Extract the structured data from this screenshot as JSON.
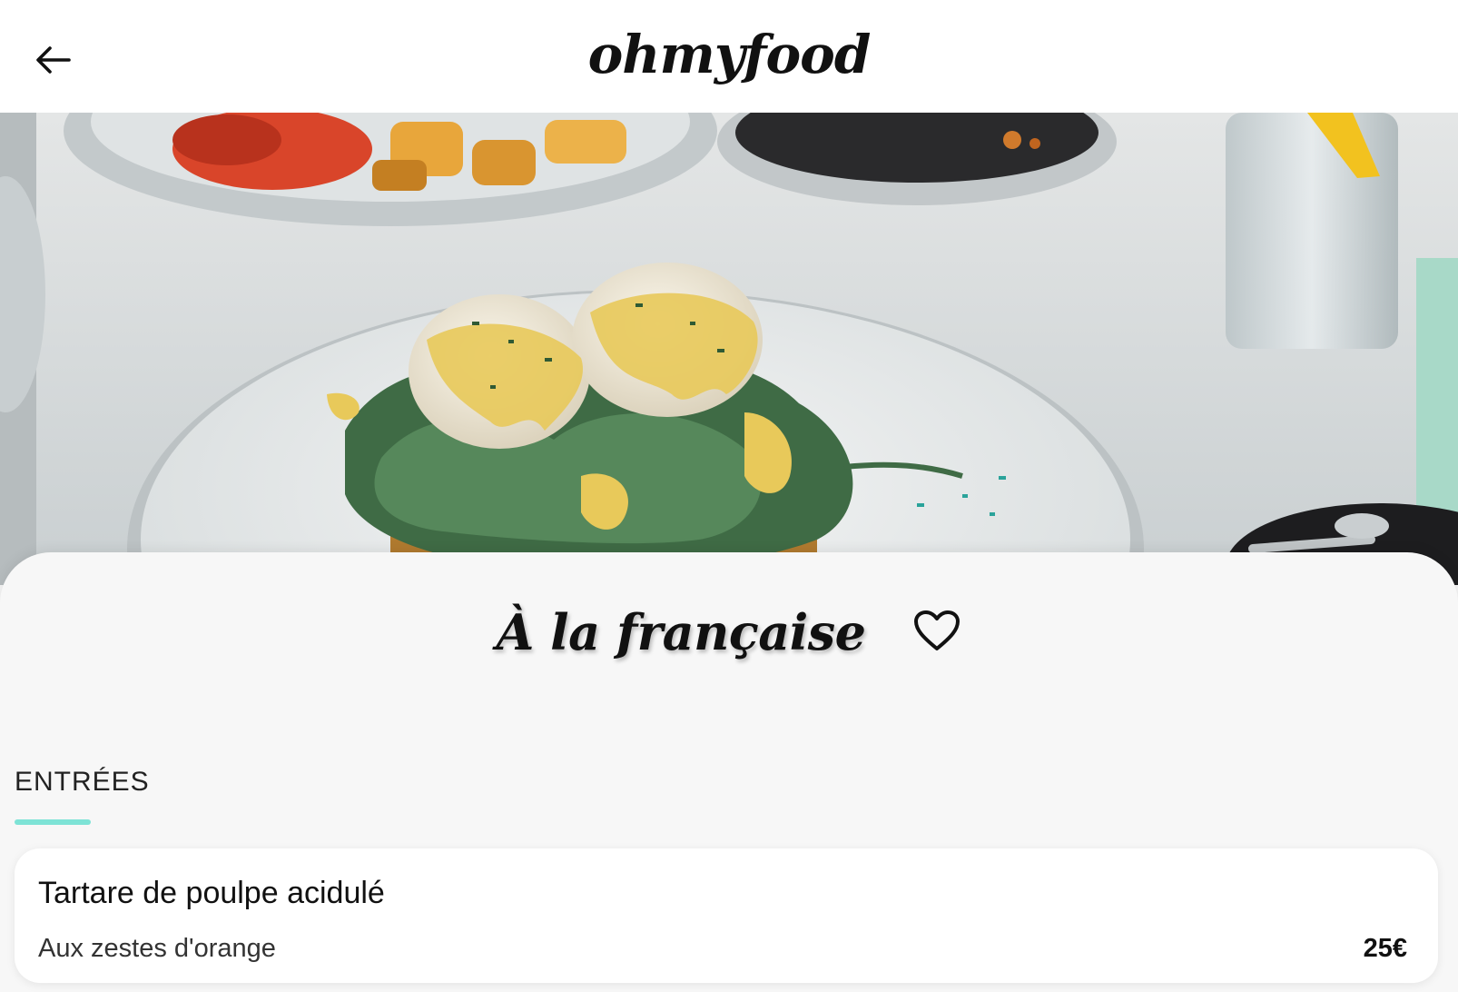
{
  "header": {
    "logo": "ohmyfood",
    "back_icon": "arrow-left-icon"
  },
  "hero": {
    "icon": "food-photo",
    "colors": {
      "table": "#d9dedf",
      "plate": "#eef0f0",
      "egg": "#f2ead6",
      "sauce": "#e8c95a",
      "greens": "#3f6b45",
      "tomato": "#d9452a",
      "potato": "#e8a63b"
    }
  },
  "restaurant": {
    "title": "À la française",
    "favorite_icon": "heart-outline-icon"
  },
  "menu": {
    "section_label": "ENTRÉES",
    "accent_color": "#7ee3d6",
    "items": [
      {
        "name": "Tartare de poulpe acidulé",
        "description": "Aux zestes d'orange",
        "price": "25€"
      }
    ]
  }
}
